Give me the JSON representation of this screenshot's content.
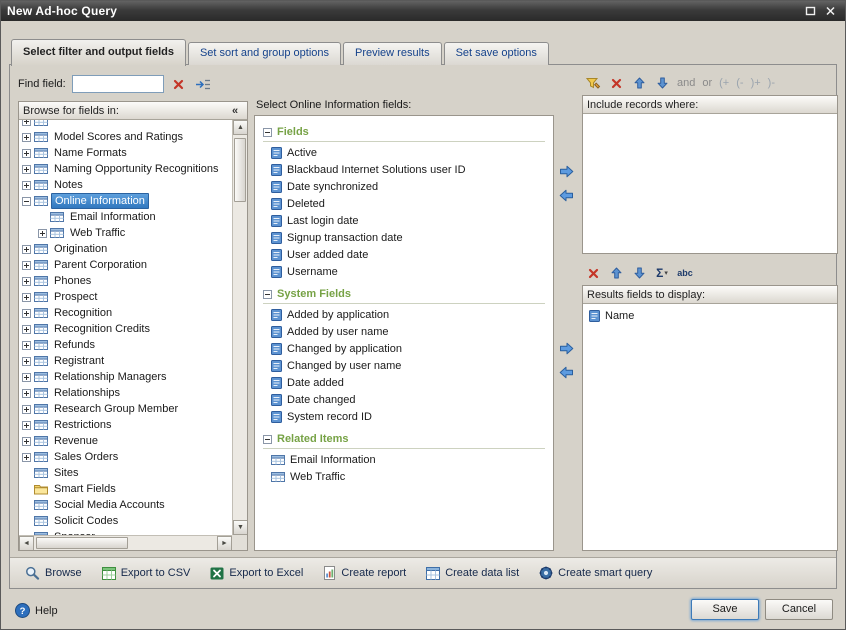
{
  "window": {
    "title": "New Ad-hoc Query"
  },
  "colors": {
    "accent_blue": "#15428b",
    "selection_blue": "#3178bf",
    "group_green": "#76a245",
    "delete_red": "#c43527",
    "save_highlight": "#3d7ab8"
  },
  "tabs": [
    {
      "label": "Select filter and output fields",
      "active": true
    },
    {
      "label": "Set sort and group options",
      "active": false
    },
    {
      "label": "Preview results",
      "active": false
    },
    {
      "label": "Set save options",
      "active": false
    }
  ],
  "find": {
    "label": "Find field:",
    "value": ""
  },
  "browse_panel": {
    "title": "Browse for fields in:",
    "collapse_glyph": "«",
    "tree": [
      {
        "label": "",
        "icon": "table",
        "expander": "+",
        "level": 0,
        "partial": "top"
      },
      {
        "label": "Model Scores and Ratings",
        "icon": "table",
        "expander": "+",
        "level": 0
      },
      {
        "label": "Name Formats",
        "icon": "table",
        "expander": "+",
        "level": 0
      },
      {
        "label": "Naming Opportunity Recognitions",
        "icon": "table",
        "expander": "+",
        "level": 0
      },
      {
        "label": "Notes",
        "icon": "table",
        "expander": "+",
        "level": 0
      },
      {
        "label": "Online Information",
        "icon": "table",
        "expander": "-",
        "level": 0,
        "selected": true
      },
      {
        "label": "Email Information",
        "icon": "table",
        "expander": "none",
        "level": 1
      },
      {
        "label": "Web Traffic",
        "icon": "table",
        "expander": "+",
        "level": 1
      },
      {
        "label": "Origination",
        "icon": "table",
        "expander": "+",
        "level": 0
      },
      {
        "label": "Parent Corporation",
        "icon": "table",
        "expander": "+",
        "level": 0
      },
      {
        "label": "Phones",
        "icon": "table",
        "expander": "+",
        "level": 0
      },
      {
        "label": "Prospect",
        "icon": "table",
        "expander": "+",
        "level": 0
      },
      {
        "label": "Recognition",
        "icon": "table",
        "expander": "+",
        "level": 0
      },
      {
        "label": "Recognition Credits",
        "icon": "table",
        "expander": "+",
        "level": 0
      },
      {
        "label": "Refunds",
        "icon": "table",
        "expander": "+",
        "level": 0
      },
      {
        "label": "Registrant",
        "icon": "table",
        "expander": "+",
        "level": 0
      },
      {
        "label": "Relationship Managers",
        "icon": "table",
        "expander": "+",
        "level": 0
      },
      {
        "label": "Relationships",
        "icon": "table",
        "expander": "+",
        "level": 0
      },
      {
        "label": "Research Group Member",
        "icon": "table",
        "expander": "+",
        "level": 0
      },
      {
        "label": "Restrictions",
        "icon": "table",
        "expander": "+",
        "level": 0
      },
      {
        "label": "Revenue",
        "icon": "table",
        "expander": "+",
        "level": 0
      },
      {
        "label": "Sales Orders",
        "icon": "table",
        "expander": "+",
        "level": 0
      },
      {
        "label": "Sites",
        "icon": "table",
        "expander": "none",
        "level": 0
      },
      {
        "label": "Smart Fields",
        "icon": "folder",
        "expander": "none",
        "level": 0
      },
      {
        "label": "Social Media Accounts",
        "icon": "table",
        "expander": "none",
        "level": 0
      },
      {
        "label": "Solicit Codes",
        "icon": "table",
        "expander": "none",
        "level": 0
      },
      {
        "label": "Sponsor",
        "icon": "table",
        "expander": "none",
        "level": 0
      }
    ]
  },
  "fields_panel": {
    "header": "Select Online Information fields:",
    "groups": [
      {
        "label": "Fields",
        "items": [
          {
            "label": "Active",
            "icon": "field"
          },
          {
            "label": "Blackbaud Internet Solutions user ID",
            "icon": "field"
          },
          {
            "label": "Date synchronized",
            "icon": "field"
          },
          {
            "label": "Deleted",
            "icon": "field"
          },
          {
            "label": "Last login date",
            "icon": "field"
          },
          {
            "label": "Signup transaction date",
            "icon": "field"
          },
          {
            "label": "User added date",
            "icon": "field"
          },
          {
            "label": "Username",
            "icon": "field"
          }
        ]
      },
      {
        "label": "System Fields",
        "items": [
          {
            "label": "Added by application",
            "icon": "field"
          },
          {
            "label": "Added by user name",
            "icon": "field"
          },
          {
            "label": "Changed by application",
            "icon": "field"
          },
          {
            "label": "Changed by user name",
            "icon": "field"
          },
          {
            "label": "Date added",
            "icon": "field"
          },
          {
            "label": "Date changed",
            "icon": "field"
          },
          {
            "label": "System record ID",
            "icon": "field"
          }
        ]
      },
      {
        "label": "Related Items",
        "items": [
          {
            "label": "Email Information",
            "icon": "table"
          },
          {
            "label": "Web Traffic",
            "icon": "table"
          }
        ]
      }
    ]
  },
  "include_panel": {
    "header": "Include records where:",
    "toolbar_icons": [
      "filter",
      "delete-x",
      "arrow-up",
      "arrow-down"
    ],
    "logic_buttons": [
      "and",
      "or"
    ],
    "group_buttons": [
      "(+",
      "(-",
      ")+",
      ")-"
    ]
  },
  "results_panel": {
    "header": "Results fields to display:",
    "toolbar_icons": [
      "delete-x",
      "arrow-up",
      "arrow-down",
      "sigma",
      "abc"
    ],
    "items": [
      {
        "label": "Name",
        "icon": "field"
      }
    ]
  },
  "action_bar": {
    "items": [
      {
        "label": "Browse",
        "icon": "magnifier"
      },
      {
        "label": "Export to CSV",
        "icon": "csv"
      },
      {
        "label": "Export to Excel",
        "icon": "excel"
      },
      {
        "label": "Create report",
        "icon": "report"
      },
      {
        "label": "Create data list",
        "icon": "datalist"
      },
      {
        "label": "Create smart query",
        "icon": "smartquery"
      }
    ]
  },
  "footer": {
    "help_label": "Help",
    "save_label": "Save",
    "cancel_label": "Cancel"
  }
}
